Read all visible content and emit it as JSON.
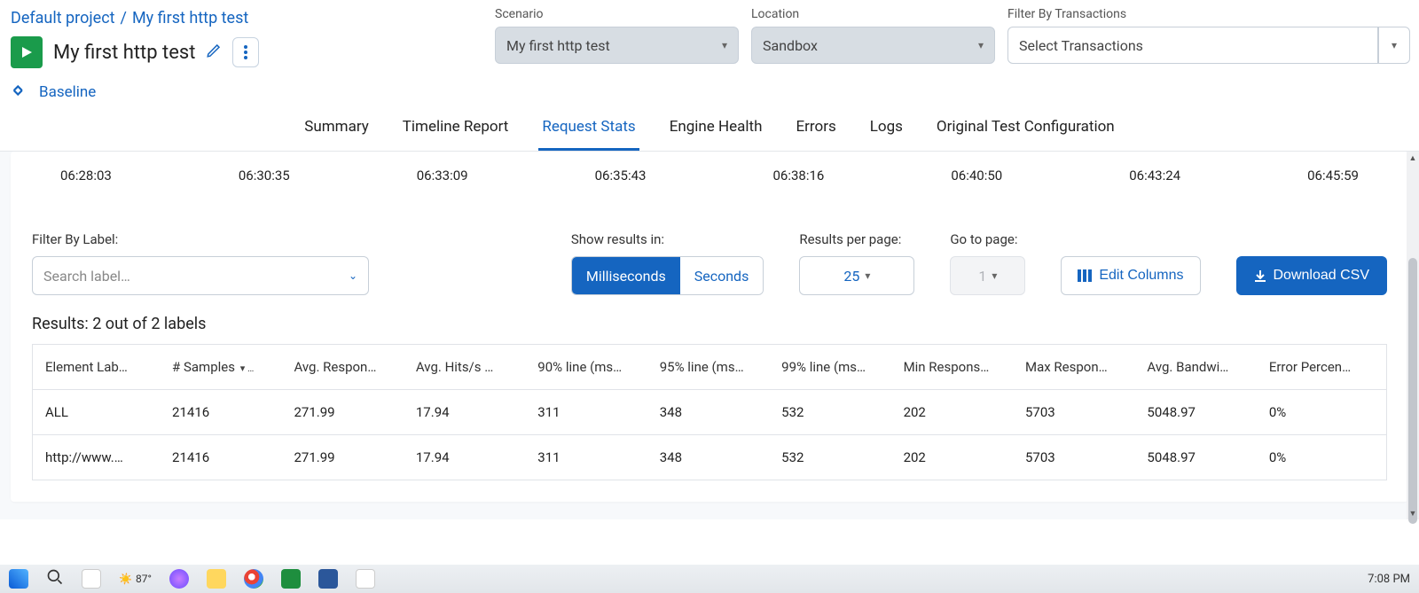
{
  "breadcrumb": {
    "project": "Default project",
    "test": "My first http test"
  },
  "title": "My first http test",
  "baseline": "Baseline",
  "filters": {
    "scenario_label": "Scenario",
    "scenario_value": "My first http test",
    "location_label": "Location",
    "location_value": "Sandbox",
    "tx_label": "Filter By Transactions",
    "tx_value": "Select Transactions"
  },
  "tabs": [
    "Summary",
    "Timeline Report",
    "Request Stats",
    "Engine Health",
    "Errors",
    "Logs",
    "Original Test Configuration"
  ],
  "active_tab": "Request Stats",
  "timeticks": [
    "06:28:03",
    "06:30:35",
    "06:33:09",
    "06:35:43",
    "06:38:16",
    "06:40:50",
    "06:43:24",
    "06:45:59"
  ],
  "controls": {
    "filter_label": "Filter By Label:",
    "filter_placeholder": "Search label…",
    "show_label": "Show results in:",
    "ms": "Milliseconds",
    "sec": "Seconds",
    "perpage_label": "Results per page:",
    "perpage_value": "25",
    "goto_label": "Go to page:",
    "goto_value": "1",
    "edit_cols": "Edit Columns",
    "download": "Download CSV"
  },
  "results_text": "Results: 2 out of 2 labels",
  "columns": [
    "Element Lab…",
    "# Samples",
    "Avg. Respon…",
    "Avg. Hits/s …",
    "90% line (ms…",
    "95% line (ms…",
    "99% line (ms…",
    "Min Respons…",
    "Max Respon…",
    "Avg. Bandwi…",
    "Error Percen…"
  ],
  "sort_suffix": "▾ …",
  "rows": [
    {
      "label": "ALL",
      "samples": "21416",
      "avg": "271.99",
      "hits": "17.94",
      "p90": "311",
      "p95": "348",
      "p99": "532",
      "min": "202",
      "max": "5703",
      "bw": "5048.97",
      "err": "0%"
    },
    {
      "label": "http://www.…",
      "samples": "21416",
      "avg": "271.99",
      "hits": "17.94",
      "p90": "311",
      "p95": "348",
      "p99": "532",
      "min": "202",
      "max": "5703",
      "bw": "5048.97",
      "err": "0%"
    }
  ],
  "taskbar": {
    "weather": "87°",
    "clock": "7:08 PM"
  }
}
